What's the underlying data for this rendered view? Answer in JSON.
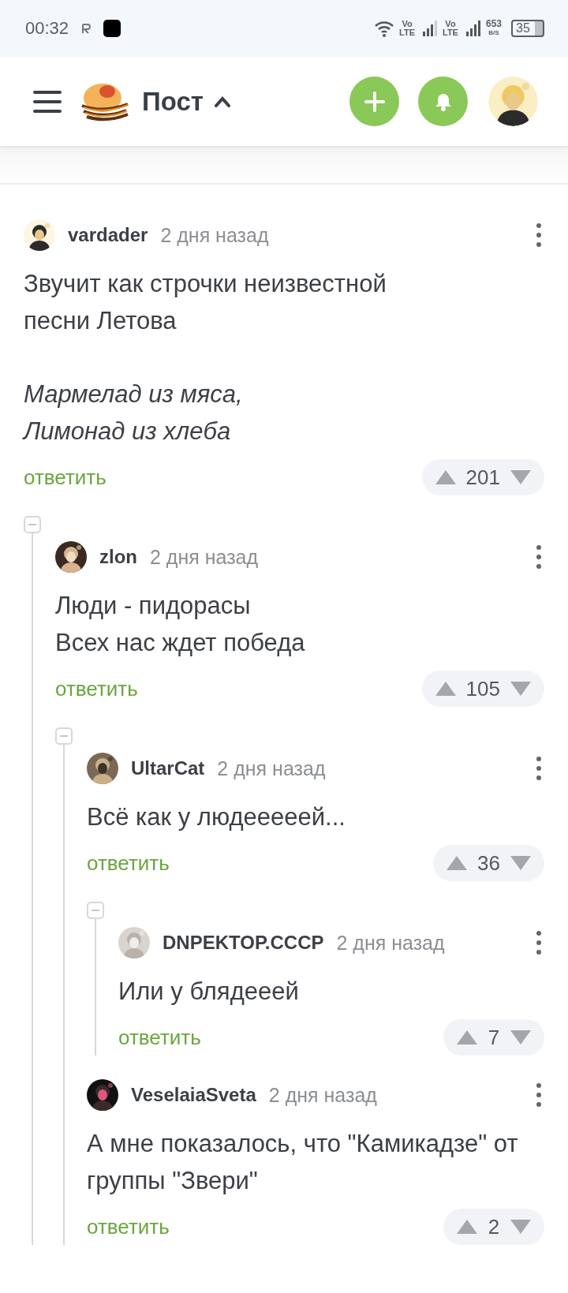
{
  "status_bar": {
    "time": "00:32",
    "sim_slots": [
      {
        "top": "Vo",
        "bottom": "LTE"
      },
      {
        "top": "Vo",
        "bottom": "LTE"
      }
    ],
    "speed": "653",
    "speed_unit": "B/S",
    "battery": "35"
  },
  "header": {
    "title": "Пост",
    "title_expanded": true
  },
  "comments": [
    {
      "author": "vardader",
      "time": "2 дня назад",
      "paragraphs": [
        {
          "text": "Звучит как строчки неизвестной\nпесни Летова",
          "italic": false
        },
        {
          "text": "Мармелад из мяса,\nЛимонад из хлеба",
          "italic": true
        }
      ],
      "reply": "ответить",
      "rating": "201",
      "expanded": true,
      "children": [
        {
          "author": "zlon",
          "time": "2 дня назад",
          "paragraphs": [
            {
              "text": "Люди - пидорасы\nВсех нас ждет победа",
              "italic": false
            }
          ],
          "reply": "ответить",
          "rating": "105",
          "expanded": true,
          "children": [
            {
              "author": "UltarCat",
              "time": "2 дня назад",
              "paragraphs": [
                {
                  "text": "Всё как у людееееей...",
                  "italic": false
                }
              ],
              "reply": "ответить",
              "rating": "36",
              "expanded": true,
              "children": [
                {
                  "author": "DNPEKTOP.CCCP",
                  "time": "2 дня назад",
                  "paragraphs": [
                    {
                      "text": "Или у блядееей",
                      "italic": false
                    }
                  ],
                  "reply": "ответить",
                  "rating": "7"
                }
              ]
            },
            {
              "author": "VeselaiaSveta",
              "time": "2 дня назад",
              "paragraphs": [
                {
                  "text": "А мне показалось, что \"Камикадзе\" от\nгруппы \"Звери\"",
                  "italic": false
                }
              ],
              "reply": "ответить",
              "rating": "2"
            }
          ]
        }
      ]
    }
  ]
}
